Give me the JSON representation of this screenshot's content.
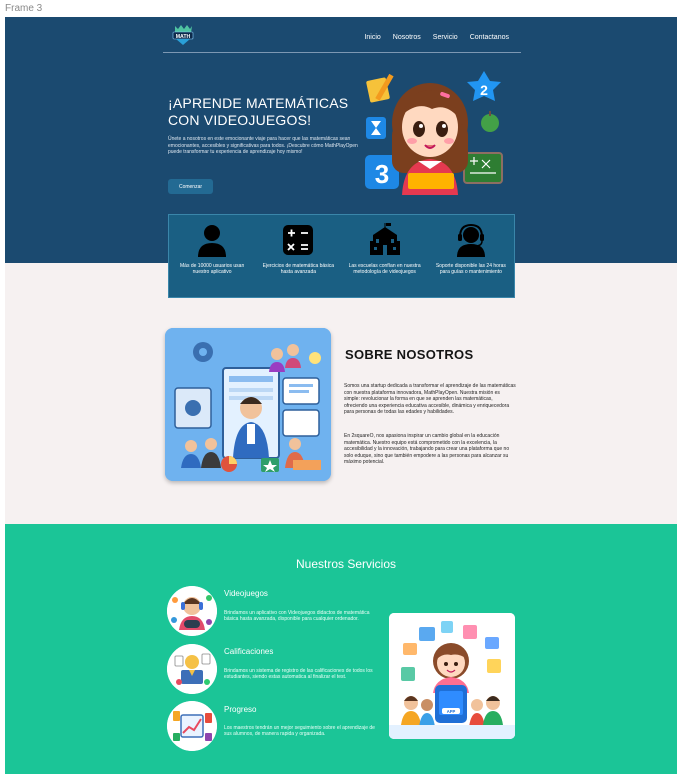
{
  "frame_label": "Frame 3",
  "nav": {
    "logo_text": "MATH",
    "links": [
      "Inicio",
      "Nosotros",
      "Servicio",
      "Contactanos"
    ]
  },
  "hero": {
    "title": "¡APRENDE MATEMÁTICAS CON VIDEOJUEGOS!",
    "description": "Únete a nosotros en este emocionante viaje para hacer que las matemáticas sean emocionantes, accesibles y significativas para todos. ¡Descubre cómo MathPlayOpen puede transformar tu experiencia de aprendizaje hoy mismo!",
    "cta": "Comenzar"
  },
  "features": [
    {
      "icon": "user-icon",
      "text": "Más de 10000 usuarios usan nuestro aplicativo"
    },
    {
      "icon": "calculator-icon",
      "text": "Ejercicios de matemática básica hasta avanzada"
    },
    {
      "icon": "school-icon",
      "text": "Las escuelas confían en nuestra metodología de videojuegos"
    },
    {
      "icon": "support-agent-icon",
      "text": "Soporte disponible las 24 horas para guías o mantenimiento"
    }
  ],
  "about": {
    "title": "SOBRE NOSOTROS",
    "paragraph1": "Somos una startup dedicada a transformar el aprendizaje de las matemáticas con nuestra plataforma innovadora, MathPlayOpen. Nuestra misión es simple: revolucionar la forma en que se aprenden las matemáticas, ofreciendo una experiencia educativa accesible, dinámica y enriquecedora para personas de todas las edades y habilidades.",
    "paragraph2": "En 2squareO, nos apasiona inspirar un cambio global en la educación matemática. Nuestro equipo está comprometido con la excelencia, la accesibilidad y la innovación, trabajando para crear una plataforma que no solo eduque, sino que también empodere a las personas para alcanzar su máximo potencial."
  },
  "services": {
    "title": "Nuestros Servicios",
    "items": [
      {
        "title": "Videojuegos",
        "text": "Brindamos un aplicativo con Videojuegos didactos de matemática básica hasta avanzada, disponible para cualquier ordenador."
      },
      {
        "title": "Calificaciones",
        "text": "Brindamos un sistema de registro de las calificaciones de todos los estudiantes, siendo estas automatica al finalizar el test."
      },
      {
        "title": "Progreso",
        "text": "Los maestros tendrán un mejor seguimiento sobre el aprendizaje de sus alumnos, de manera rapida y organizada."
      }
    ],
    "phone_label": "APP"
  },
  "colors": {
    "hero_bg": "#1b4a70",
    "features_bg": "#1a5f83",
    "page_bg": "#f6f1f1",
    "services_bg": "#1bc597",
    "button": "#236a93"
  }
}
